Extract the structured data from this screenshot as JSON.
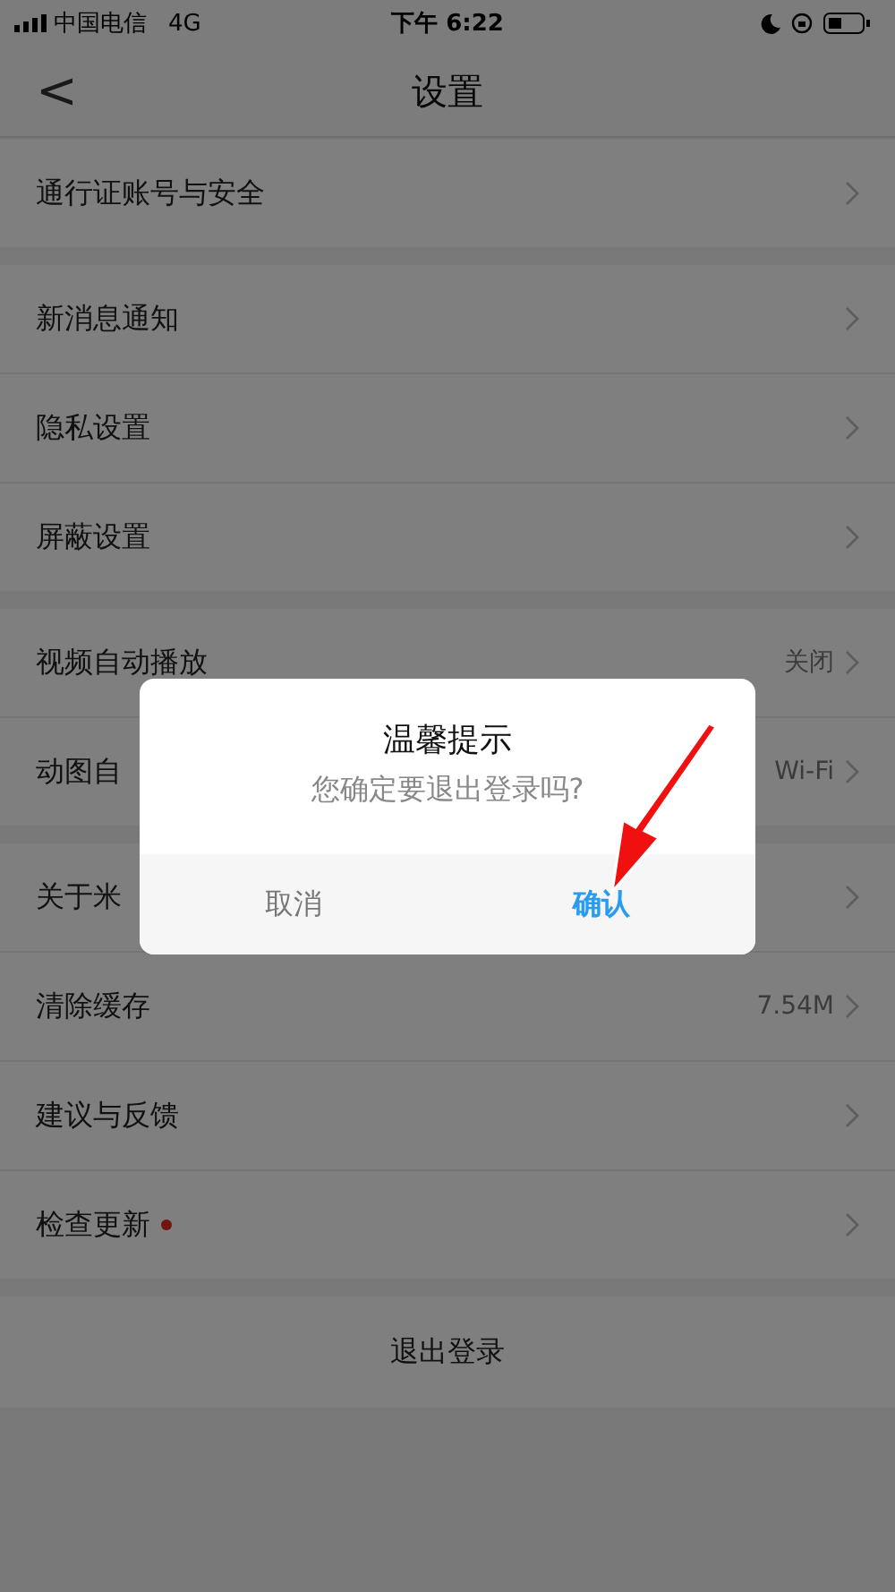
{
  "status_bar": {
    "carrier": "中国电信",
    "network": "4G",
    "time": "下午 6:22"
  },
  "nav": {
    "back": "<",
    "title": "设置"
  },
  "groups": [
    [
      {
        "label": "通行证账号与安全",
        "badge": false
      }
    ],
    [
      {
        "label": "新消息通知",
        "badge": false
      },
      {
        "label": "隐私设置",
        "badge": false
      },
      {
        "label": "屏蔽设置",
        "badge": false
      }
    ],
    [
      {
        "label": "视频自动播放",
        "value": "关闭",
        "badge": false
      },
      {
        "label": "动图自",
        "value": "Wi-Fi",
        "badge": false
      }
    ],
    [
      {
        "label": "关于米",
        "badge": false
      },
      {
        "label": "清除缓存",
        "value": "7.54M",
        "badge": false
      },
      {
        "label": "建议与反馈",
        "badge": false
      },
      {
        "label": "检查更新",
        "badge": true
      }
    ]
  ],
  "logout": "退出登录",
  "dialog": {
    "title": "温馨提示",
    "message": "您确定要退出登录吗?",
    "buttons": [
      {
        "label": "取消",
        "kind": "cancel"
      },
      {
        "label": "确认",
        "kind": "confirm"
      }
    ]
  }
}
